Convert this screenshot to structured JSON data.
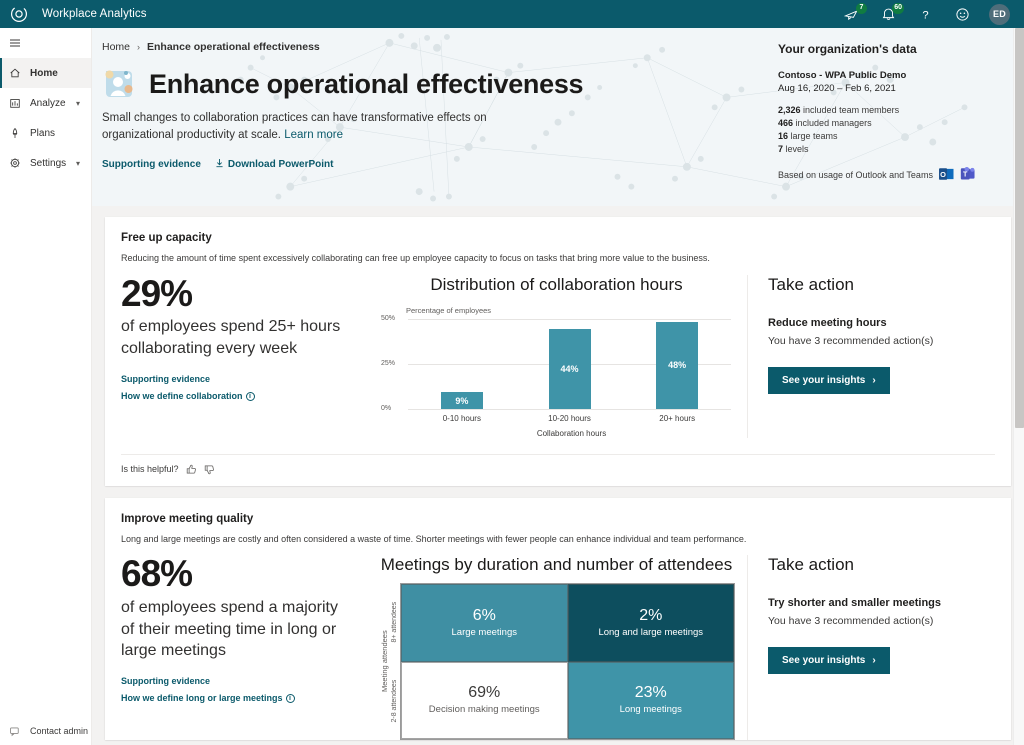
{
  "topbar": {
    "product_name": "Workplace Analytics",
    "logo_icon": "workplace-analytics-logo",
    "icons": [
      {
        "name": "feedback-icon",
        "badge": "7"
      },
      {
        "name": "notifications-icon",
        "badge": "60"
      },
      {
        "name": "help-icon",
        "badge": ""
      },
      {
        "name": "smiley-feedback-icon",
        "badge": ""
      }
    ],
    "avatar_initials": "ED",
    "accent_color": "#0b5a6b"
  },
  "sidebar": {
    "menu_icon": "hamburger-icon",
    "items": [
      {
        "label": "Home",
        "icon": "home-icon",
        "active": true,
        "expandable": false
      },
      {
        "label": "Analyze",
        "icon": "chart-bar-icon",
        "active": false,
        "expandable": true
      },
      {
        "label": "Plans",
        "icon": "rocket-icon",
        "active": false,
        "expandable": false
      },
      {
        "label": "Settings",
        "icon": "gear-icon",
        "active": false,
        "expandable": true
      }
    ],
    "footer": {
      "label": "Contact admin",
      "icon": "contact-admin-icon"
    }
  },
  "hero": {
    "breadcrumb": {
      "home": "Home",
      "separator": "›",
      "current": "Enhance operational effectiveness"
    },
    "page_icon": "person-collaboration-icon",
    "title": "Enhance operational effectiveness",
    "subtitle": "Small changes to collaboration practices can have transformative effects on organizational productivity at scale.",
    "learn_more": "Learn more",
    "supporting_evidence": "Supporting evidence",
    "download": "Download PowerPoint",
    "download_icon": "download-icon"
  },
  "org_data": {
    "heading": "Your organization's data",
    "tenant": "Contoso - WPA Public Demo",
    "date_range": "Aug 16, 2020 – Feb 6, 2021",
    "stats": [
      {
        "value": "2,326",
        "label": "included team members"
      },
      {
        "value": "466",
        "label": "included managers"
      },
      {
        "value": "16",
        "label": "large teams"
      },
      {
        "value": "7",
        "label": "levels"
      }
    ],
    "based_on": "Based on usage of Outlook and Teams",
    "source_icons": [
      "outlook-icon",
      "teams-icon"
    ]
  },
  "cards": [
    {
      "title": "Free up capacity",
      "description": "Reducing the amount of time spent excessively collaborating can free up employee capacity to focus on tasks that bring more value to the business.",
      "stat_value": "29%",
      "stat_text": "of employees spend 25+ hours collaborating every week",
      "links": [
        {
          "label": "Supporting evidence",
          "info": false
        },
        {
          "label": "How we define collaboration",
          "info": true
        }
      ],
      "action": {
        "heading": "Take action",
        "subheading": "Reduce meeting hours",
        "description": "You have 3 recommended action(s)",
        "button": "See your insights",
        "button_icon": "chevron-right-icon"
      },
      "footer": {
        "helpful": "Is this helpful?",
        "thumbs_up": "thumbs-up-icon",
        "thumbs_down": "thumbs-down-icon"
      }
    },
    {
      "title": "Improve meeting quality",
      "description": "Long and large meetings are costly and often considered a waste of time. Shorter meetings with fewer people can enhance individual and team performance.",
      "stat_value": "68%",
      "stat_text": "of employees spend a majority of their meeting time in long or large meetings",
      "links": [
        {
          "label": "Supporting evidence",
          "info": false
        },
        {
          "label": "How we define long or large meetings",
          "info": true
        }
      ],
      "action": {
        "heading": "Take action",
        "subheading": "Try shorter and smaller meetings",
        "description": "You have 3 recommended action(s)",
        "button": "See your insights",
        "button_icon": "chevron-right-icon"
      }
    }
  ],
  "chart_data": [
    {
      "type": "bar",
      "title": "Distribution of collaboration hours",
      "ylabel": "Percentage of employees",
      "xlabel": "Collaboration hours",
      "categories": [
        "0-10 hours",
        "10-20 hours",
        "20+ hours"
      ],
      "values": [
        9,
        44,
        48
      ],
      "value_labels": [
        "9%",
        "44%",
        "48%"
      ],
      "yticks": [
        "0%",
        "25%",
        "50%"
      ],
      "ylim": [
        0,
        50
      ],
      "grid": true,
      "legend": "none",
      "bar_color": "#3f94a8"
    },
    {
      "type": "heatmap",
      "title": "Meetings by duration and number of attendees",
      "ylabel": "Meeting attendees",
      "ytick_labels": [
        "8+ attendees",
        "2-8 attendees"
      ],
      "cells": [
        {
          "value": "6%",
          "label": "Large meetings",
          "color": "#3f8fa3",
          "text_color": "#ffffff",
          "row": 0,
          "col": 0
        },
        {
          "value": "2%",
          "label": "Long and large meetings",
          "color": "#0d4e5e",
          "text_color": "#ffffff",
          "row": 0,
          "col": 1
        },
        {
          "value": "69%",
          "label": "Decision making meetings",
          "color": "#ffffff",
          "text_color": "#3b3a39",
          "row": 1,
          "col": 0
        },
        {
          "value": "23%",
          "label": "Long meetings",
          "color": "#3f94a8",
          "text_color": "#ffffff",
          "row": 1,
          "col": 1
        }
      ]
    }
  ]
}
